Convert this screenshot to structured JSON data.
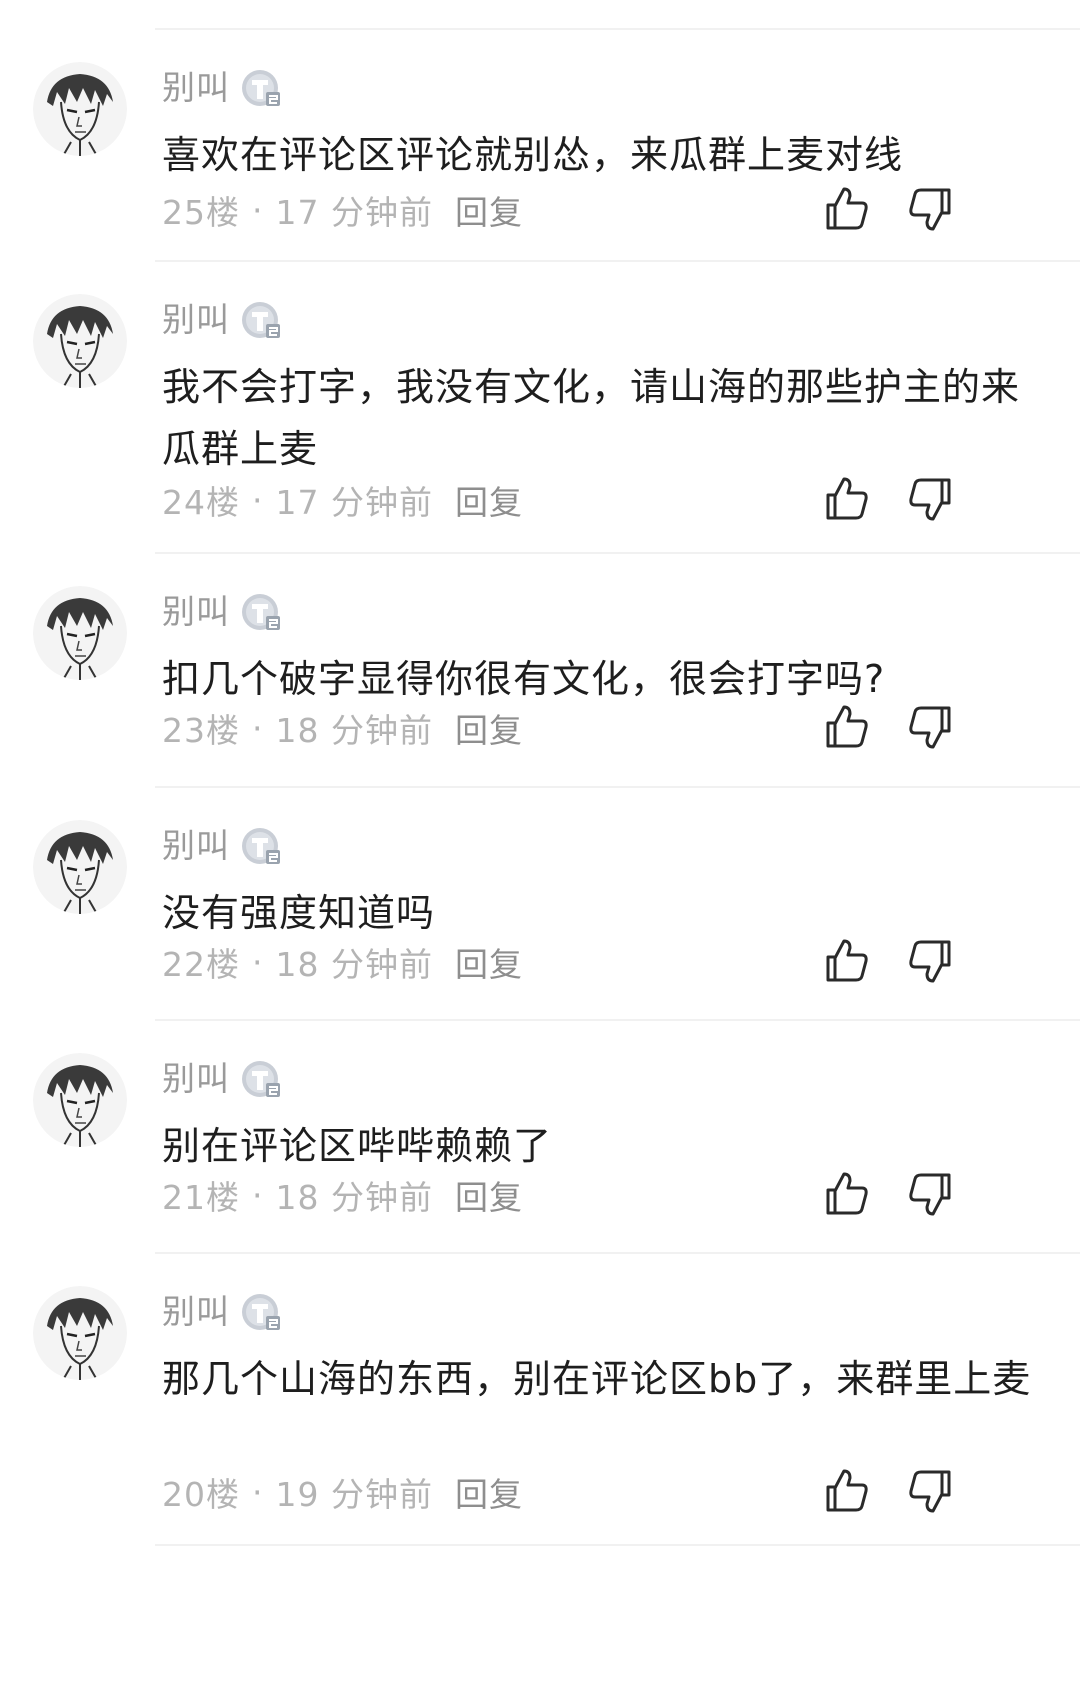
{
  "comments": [
    {
      "username": "别叫",
      "level_icon": "level-t2-badge",
      "text": "喜欢在评论区评论就别怂，来瓜群上麦对线",
      "floor": "25楼",
      "separator": "·",
      "time": "17 分钟前",
      "reply_label": "回复"
    },
    {
      "username": "别叫",
      "level_icon": "level-t2-badge",
      "text": "我不会打字，我没有文化，请山海的那些护主的来瓜群上麦",
      "floor": "24楼",
      "separator": "·",
      "time": "17 分钟前",
      "reply_label": "回复"
    },
    {
      "username": "别叫",
      "level_icon": "level-t2-badge",
      "text": "扣几个破字显得你很有文化，很会打字吗?",
      "floor": "23楼",
      "separator": "·",
      "time": "18 分钟前",
      "reply_label": "回复"
    },
    {
      "username": "别叫",
      "level_icon": "level-t2-badge",
      "text": "没有强度知道吗",
      "floor": "22楼",
      "separator": "·",
      "time": "18 分钟前",
      "reply_label": "回复"
    },
    {
      "username": "别叫",
      "level_icon": "level-t2-badge",
      "text": "别在评论区哔哔赖赖了",
      "floor": "21楼",
      "separator": "·",
      "time": "18 分钟前",
      "reply_label": "回复"
    },
    {
      "username": "别叫",
      "level_icon": "level-t2-badge",
      "text": "那几个山海的东西，别在评论区bb了，来群里上麦",
      "floor": "20楼",
      "separator": "·",
      "time": "19 分钟前",
      "reply_label": "回复"
    }
  ],
  "icons": {
    "like": "thumbs-up-icon",
    "dislike": "thumbs-down-icon"
  },
  "colors": {
    "username": "#9a9a9a",
    "meta": "#b4b4b4",
    "reply": "#8e8e8e",
    "content": "#1e1e1e",
    "divider": "#f1f1f1"
  }
}
